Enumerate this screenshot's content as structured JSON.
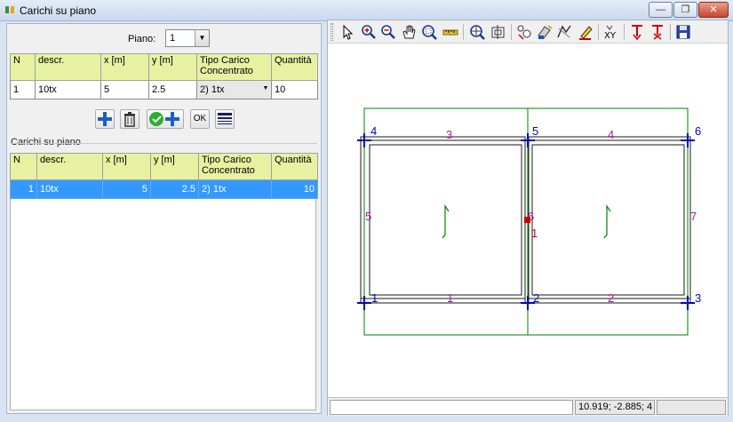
{
  "window": {
    "title": "Carichi su piano"
  },
  "piano": {
    "label": "Piano:",
    "value": "1"
  },
  "input_table": {
    "headers": [
      "N",
      "descr.",
      "x [m]",
      "y [m]",
      "Tipo Carico\nConcentrato",
      "Quantità"
    ],
    "row": [
      "1",
      "10tx",
      "5",
      "2.5",
      "2) 1tx",
      "10"
    ]
  },
  "buttons": {
    "ok": "OK"
  },
  "list": {
    "group_label": "Carichi su piano",
    "headers": [
      "N",
      "descr.",
      "x [m]",
      "y [m]",
      "Tipo Carico\nConcentrato",
      "Quantità"
    ],
    "rows": [
      [
        "1",
        "10tx",
        "5",
        "2.5",
        "2) 1tx",
        "10"
      ]
    ]
  },
  "toolbar": {
    "icons": [
      "pointer-icon",
      "zoom-in-icon",
      "zoom-out-icon",
      "pan-hand-icon",
      "zoom-window-icon",
      "measure-ruler-icon",
      "zoom-extents-icon",
      "zoom-previous-icon",
      "select-nodes-icon",
      "fill-brush-icon",
      "redraw-icon",
      "highlight-pen-icon",
      "axes-xy-icon",
      "load-arrow-icon",
      "load-star-icon",
      "save-icon"
    ]
  },
  "drawing": {
    "node_labels": [
      "1",
      "2",
      "3",
      "4",
      "5",
      "6"
    ],
    "beam_labels": [
      "1",
      "2",
      "3",
      "4",
      "5",
      "6",
      "7"
    ],
    "load_label": "1",
    "colors": {
      "frame": "#1a1a1a",
      "nodes": "#0000cc",
      "beams": "#a020a0",
      "outline": "#008000",
      "load": "#cc0000"
    }
  },
  "status": {
    "coords": "10.919; -2.885; 4"
  }
}
